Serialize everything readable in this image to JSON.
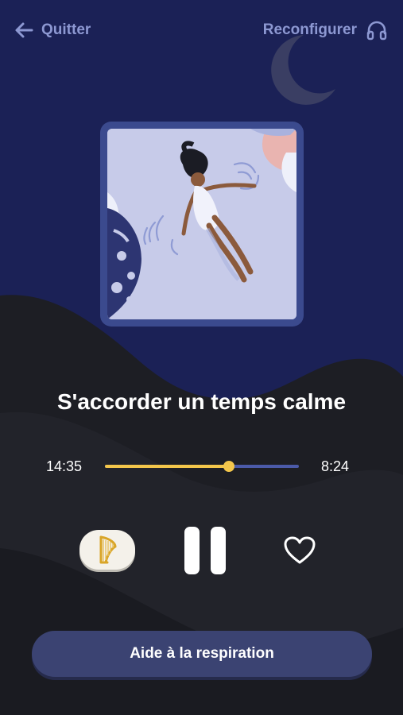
{
  "header": {
    "quit_label": "Quitter",
    "reconfigure_label": "Reconfigurer"
  },
  "track": {
    "title": "S'accorder un temps calme",
    "elapsed": "14:35",
    "remaining": "8:24",
    "progress_fraction": 0.64
  },
  "controls": {
    "ambient_sound_icon": "harp-icon",
    "play_state_icon": "pause-icon",
    "favorite_icon": "heart-icon"
  },
  "footer": {
    "breathing_help_label": "Aide à la respiration"
  },
  "colors": {
    "background_sky": "#1b2156",
    "background_hills": "#1f2026",
    "accent": "#f3c64b",
    "secondary_text": "#8d98d2",
    "button_dark": "#3b4372"
  }
}
